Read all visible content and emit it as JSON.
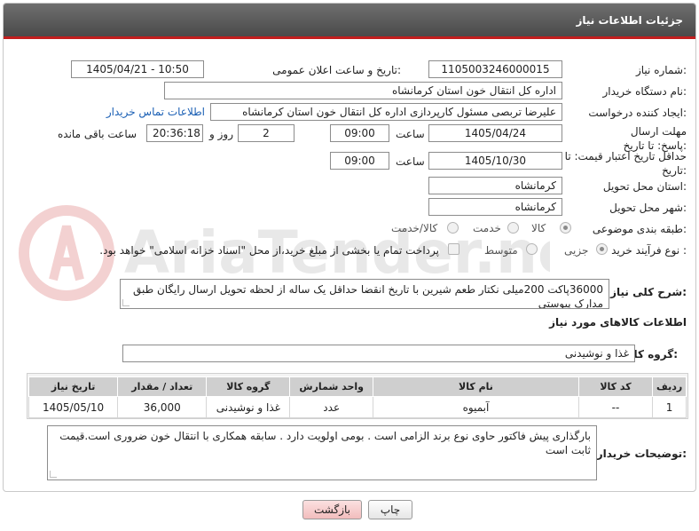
{
  "panel": {
    "title": "جزئیات اطلاعات نیاز"
  },
  "form": {
    "need_number_label": "شماره نیاز:",
    "need_number": "1105003246000015",
    "announce_label": "تاریخ و ساعت اعلان عمومی:",
    "announce_value": "1405/04/21 - 10:50",
    "buyer_org_label": "نام دستگاه خریدار:",
    "buyer_org": "اداره کل انتقال خون استان کرمانشاه",
    "requester_label": "ایجاد کننده درخواست:",
    "requester": "علیرضا تربصی مسئول کارپردازی اداره کل انتقال خون استان کرمانشاه",
    "contact_link": "اطلاعات تماس خریدار",
    "reply_deadline_label": "مهلت ارسال پاسخ: تا تاریخ:",
    "reply_date": "1405/04/24",
    "time_label": "ساعت",
    "reply_time": "09:00",
    "days_value": "2",
    "days_label": "روز و",
    "remaining_time": "20:36:18",
    "remaining_label": "ساعت باقی مانده",
    "price_deadline_label": "حداقل تاریخ اعتبار قیمت: تا تاریخ:",
    "price_date": "1405/10/30",
    "price_time": "09:00",
    "province_label": "استان محل تحویل:",
    "province": "کرمانشاه",
    "city_label": "شهر محل تحویل:",
    "city": "کرمانشاه",
    "category_label": "طبقه بندی موضوعی:",
    "category_options": [
      "کالا",
      "خدمت",
      "کالا/خدمت"
    ],
    "process_label": "نوع فرآیند خرید :",
    "process_options": [
      "جزیی",
      "متوسط"
    ],
    "payment_note": "پرداخت تمام یا بخشی از مبلغ خرید،از محل \"اسناد خزانه اسلامی\" خواهد بود.",
    "description_label": "شرح کلی نیاز:",
    "description": "36000پاکت 200میلی نکتار طعم شیرین با تاریخ انقضا حداقل یک ساله از لحظه تحویل ارسال رایگان طبق مدارک پیوستی",
    "goods_info_title": "اطلاعات کالاهای مورد نیاز",
    "goods_group_label": "گروه کالا:",
    "goods_group": "غذا و نوشیدنی",
    "buyer_notes_label": "توضیحات خریدار:",
    "buyer_notes": "بارگذاری پیش فاکتور حاوی نوع برند الزامی است . بومی اولویت دارد . سابقه همکاری با انتقال خون ضروری است.قیمت ثابت است"
  },
  "table": {
    "headers": [
      "ردیف",
      "کد کالا",
      "نام کالا",
      "واحد شمارش",
      "گروه کالا",
      "تعداد / مقدار",
      "تاریخ نیاز"
    ],
    "rows": [
      [
        "1",
        "--",
        "آبمیوه",
        "عدد",
        "غذا و نوشیدنی",
        "36,000",
        "1405/05/10"
      ]
    ]
  },
  "buttons": {
    "print": "چاپ",
    "back": "بازگشت"
  },
  "watermark": {
    "text": "AriaTender.net"
  },
  "colors": {
    "header_bar": "#555555",
    "accent_red": "#c21e1e",
    "link": "#1a5fb4",
    "back_button": "#f6c9c9"
  }
}
